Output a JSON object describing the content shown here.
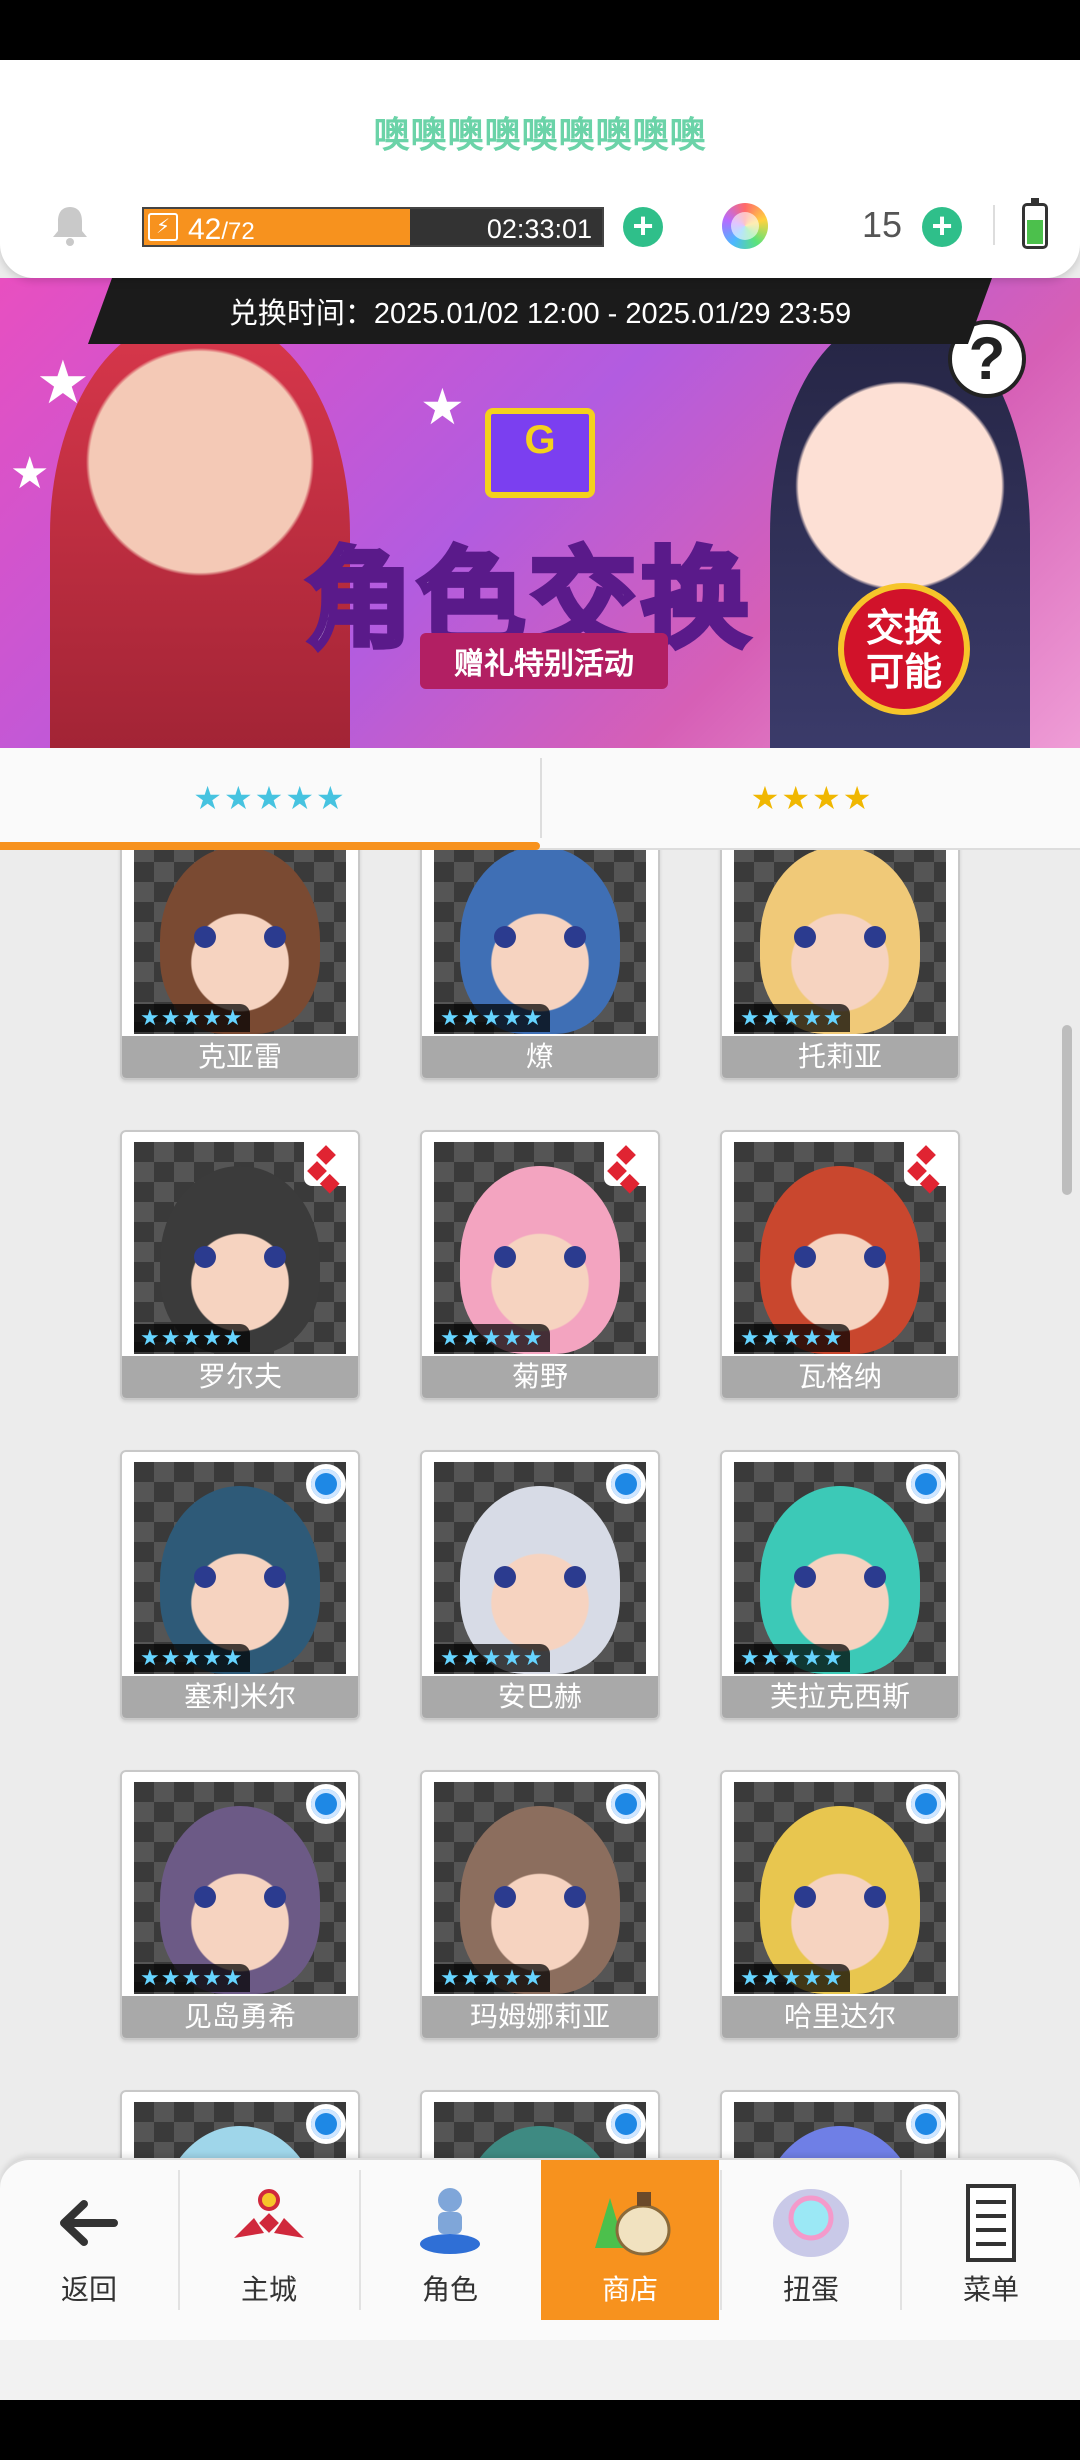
{
  "header": {
    "title": "噢噢噢噢噢噢噢噢噢",
    "stamina": {
      "current": "42",
      "max": "/72",
      "fill_fraction": 0.58
    },
    "timer": "02:33:01",
    "gem_count": "15",
    "battery_level": 0.6,
    "icons": {
      "notification": "bell-icon",
      "stamina": "lightning-icon",
      "gem": "rainbow-gem-icon",
      "battery": "battery-icon",
      "add": "plus-icon"
    }
  },
  "banner": {
    "exchange_period": "兑换时间：2025.01/02 12:00 - 2025.01/29 23:59",
    "title": "角色交换",
    "subtitle": "赠礼特别活动",
    "badge_line1": "交换",
    "badge_line2": "可能",
    "help": "?"
  },
  "tabs": [
    {
      "label": "★★★★★",
      "active": true
    },
    {
      "label": "★★★★",
      "active": false
    }
  ],
  "characters": [
    {
      "name": "克亚雷",
      "stars": "★★★★★",
      "badge": "none",
      "color": "#7a4a32"
    },
    {
      "name": "燎",
      "stars": "★★★★★",
      "badge": "none",
      "color": "#3f6fb5"
    },
    {
      "name": "托莉亚",
      "stars": "★★★★★",
      "badge": "none",
      "color": "#f0c978"
    },
    {
      "name": "罗尔夫",
      "stars": "★★★★★",
      "badge": "diamond",
      "color": "#3b3b3b"
    },
    {
      "name": "菊野",
      "stars": "★★★★★",
      "badge": "diamond",
      "color": "#f3a4c0"
    },
    {
      "name": "瓦格纳",
      "stars": "★★★★★",
      "badge": "diamond",
      "color": "#c9472e"
    },
    {
      "name": "塞利米尔",
      "stars": "★★★★★",
      "badge": "circle",
      "color": "#2e5a78"
    },
    {
      "name": "安巴赫",
      "stars": "★★★★★",
      "badge": "circle",
      "color": "#d7dbe6"
    },
    {
      "name": "芙拉克西斯",
      "stars": "★★★★★",
      "badge": "circle",
      "color": "#3cc9b7"
    },
    {
      "name": "见岛勇希",
      "stars": "★★★★★",
      "badge": "circle",
      "color": "#6c5a86"
    },
    {
      "name": "玛姆娜莉亚",
      "stars": "★★★★★",
      "badge": "circle",
      "color": "#8c6e5e"
    },
    {
      "name": "哈里达尔",
      "stars": "★★★★★",
      "badge": "circle",
      "color": "#e8c64f"
    },
    {
      "name": "",
      "stars": "",
      "badge": "circle",
      "color": "#9fd6ea"
    },
    {
      "name": "",
      "stars": "",
      "badge": "circle",
      "color": "#3e8a82"
    },
    {
      "name": "",
      "stars": "",
      "badge": "circle",
      "color": "#6f7fe6"
    }
  ],
  "nav": [
    {
      "label": "返回",
      "icon": "back-arrow-icon"
    },
    {
      "label": "主城",
      "icon": "castle-icon"
    },
    {
      "label": "角色",
      "icon": "character-statue-icon"
    },
    {
      "label": "商店",
      "icon": "shop-bag-icon",
      "active": true
    },
    {
      "label": "扭蛋",
      "icon": "gacha-portal-icon"
    },
    {
      "label": "菜单",
      "icon": "menu-list-icon"
    }
  ]
}
